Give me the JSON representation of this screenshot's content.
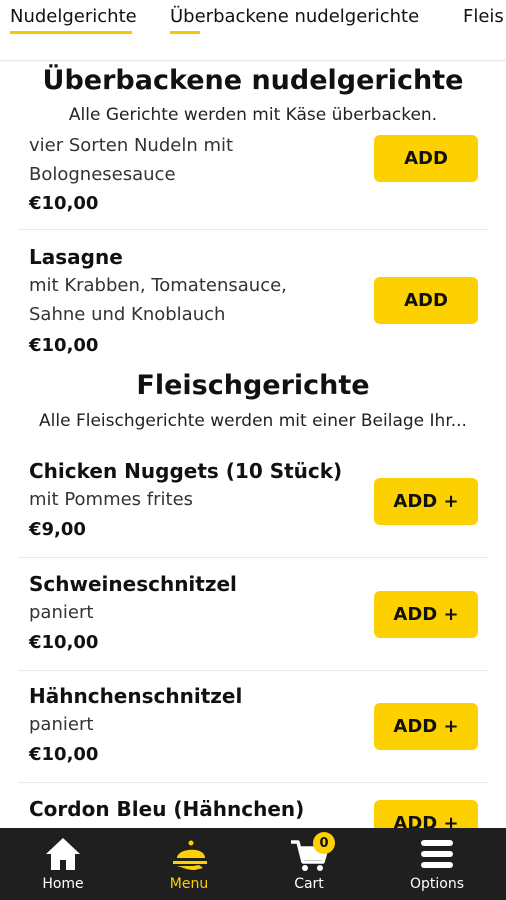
{
  "tabs": [
    {
      "label": "Nudelgerichte"
    },
    {
      "label": "Überbackene nudelgerichte"
    },
    {
      "label": "Fleis"
    }
  ],
  "sections": [
    {
      "title": "Überbackene nudelgerichte",
      "subtitle": "Alle Gerichte werden mit Käse überbacken.",
      "items": [
        {
          "desc_lines": [
            "vier Sorten Nudeln mit",
            "Bolognesesauce"
          ],
          "price": "€10,00",
          "button": "ADD"
        },
        {
          "name": "Lasagne",
          "desc_lines": [
            "mit Krabben, Tomatensauce,",
            "Sahne und Knoblauch"
          ],
          "price": "€10,00",
          "button": "ADD"
        }
      ]
    },
    {
      "title": "Fleischgerichte",
      "subtitle": "Alle Fleischgerichte werden mit einer Beilage Ihr...",
      "items": [
        {
          "name": "Chicken Nuggets (10 Stück)",
          "desc": "mit Pommes frites",
          "price": "€9,00",
          "button": "ADD +"
        },
        {
          "name": "Schweineschnitzel",
          "desc": "paniert",
          "price": "€10,00",
          "button": "ADD +"
        },
        {
          "name": "Hähnchenschnitzel",
          "desc": "paniert",
          "price": "€10,00",
          "button": "ADD +"
        },
        {
          "name": "Cordon Bleu (Hähnchen)",
          "button": "ADD +"
        }
      ]
    }
  ],
  "navbar": {
    "home": "Home",
    "menu": "Menu",
    "cart": "Cart",
    "cart_count": "0",
    "options": "Options"
  },
  "colors": {
    "accent": "#fdd000",
    "navbar_bg": "#1f1f1f"
  }
}
